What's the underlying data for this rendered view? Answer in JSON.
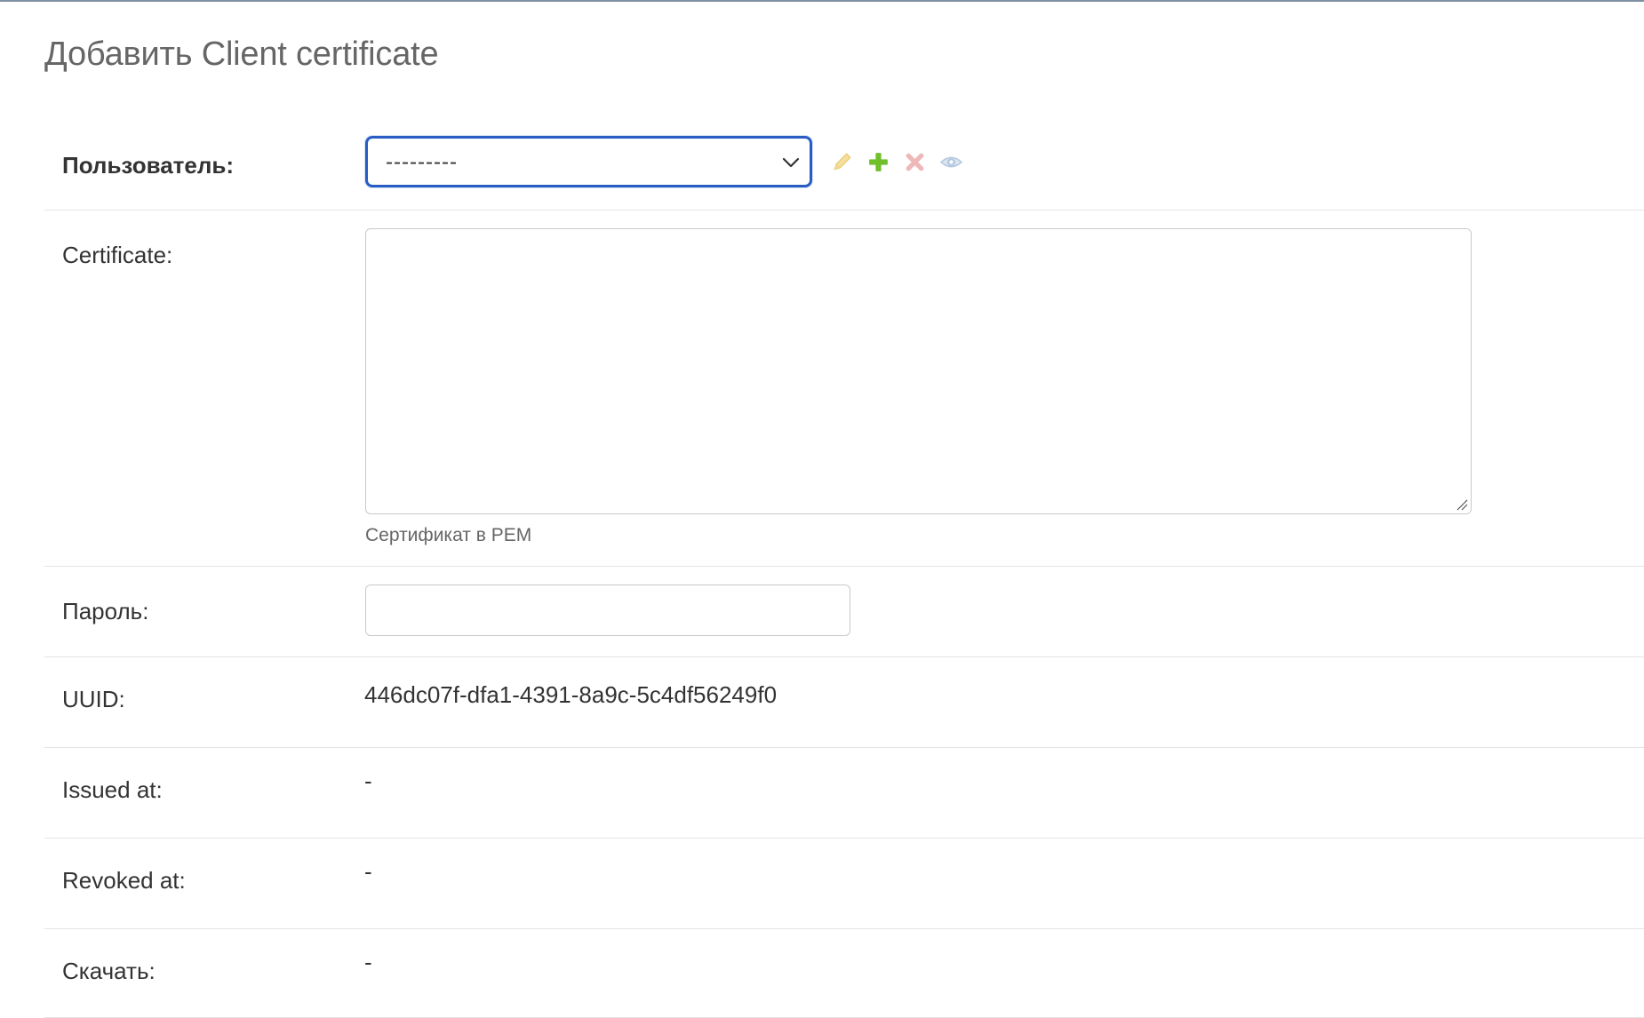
{
  "page": {
    "title": "Добавить Client certificate"
  },
  "fields": {
    "user": {
      "label": "Пользователь:",
      "selected_value": "---------",
      "actions": [
        "pencil-icon",
        "plus-icon",
        "x-icon",
        "eye-icon"
      ]
    },
    "certificate": {
      "label": "Certificate:",
      "value": "",
      "help_text": "Сертификат в PEM"
    },
    "password": {
      "label": "Пароль:",
      "value": ""
    },
    "uuid": {
      "label": "UUID:",
      "value": "446dc07f-dfa1-4391-8a9c-5c4df56249f0"
    },
    "issued_at": {
      "label": "Issued at:",
      "value": "-"
    },
    "revoked_at": {
      "label": "Revoked at:",
      "value": "-"
    },
    "download": {
      "label": "Скачать:",
      "value": "-"
    }
  },
  "colors": {
    "focus_border": "#2a5dc4",
    "add_icon": "#70bf2b",
    "delete_icon": "#efb8b8",
    "change_icon": "#f5dfa0",
    "view_icon": "#b7c9e0"
  }
}
